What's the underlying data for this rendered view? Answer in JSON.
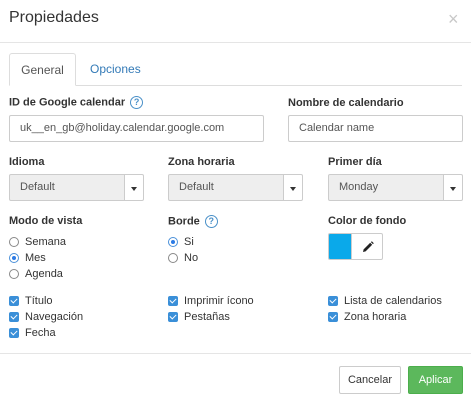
{
  "dialog": {
    "title": "Propiedades",
    "close_glyph": "×"
  },
  "tabs": [
    {
      "label": "General",
      "active": true
    },
    {
      "label": "Opciones",
      "active": false
    }
  ],
  "google_id": {
    "label": "ID de Google calendar",
    "help_glyph": "?",
    "value": "uk__en_gb@holiday.calendar.google.com"
  },
  "calendar_name": {
    "label": "Nombre de calendario",
    "placeholder": "Calendar name"
  },
  "language": {
    "label": "Idioma",
    "selected": "Default"
  },
  "timezone": {
    "label": "Zona horaria",
    "selected": "Default"
  },
  "first_day": {
    "label": "Primer día",
    "selected": "Monday"
  },
  "view_mode": {
    "label": "Modo de vista",
    "options": [
      {
        "label": "Semana",
        "checked": false
      },
      {
        "label": "Mes",
        "checked": true
      },
      {
        "label": "Agenda",
        "checked": false
      }
    ]
  },
  "border": {
    "label": "Borde",
    "help_glyph": "?",
    "options": [
      {
        "label": "Si",
        "checked": true
      },
      {
        "label": "No",
        "checked": false
      }
    ]
  },
  "background_color": {
    "label": "Color de fondo",
    "color": "#0aa9ea",
    "edit_icon": "pencil-icon"
  },
  "checkboxes": {
    "col1": [
      "Título",
      "Navegación",
      "Fecha"
    ],
    "col2": [
      "Imprimir ícono",
      "Pestañas"
    ],
    "col3": [
      "Lista de calendarios",
      "Zona horaria"
    ]
  },
  "buttons": {
    "cancel": "Cancelar",
    "apply": "Aplicar"
  },
  "colors": {
    "accent": "#337ab7",
    "apply_green": "#5cb85c",
    "checkbox_blue": "#3a8fd8"
  }
}
